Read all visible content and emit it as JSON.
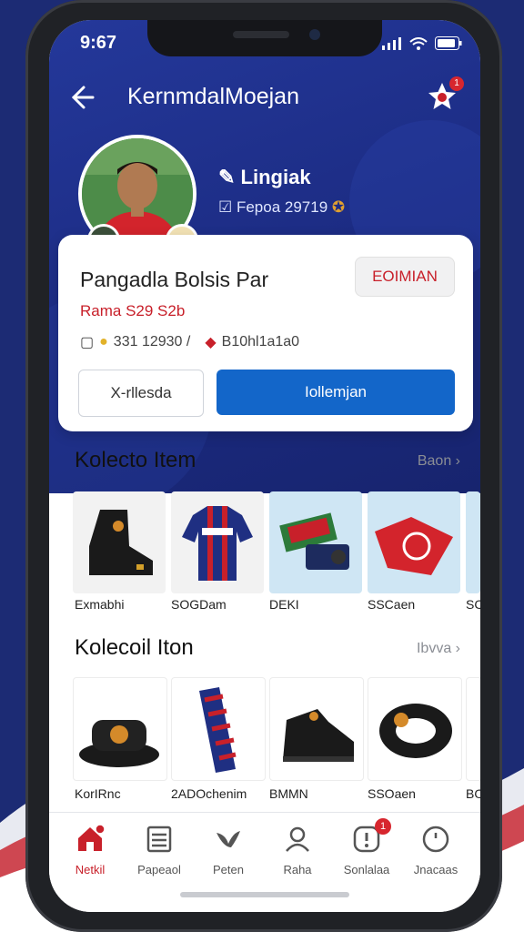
{
  "status_bar": {
    "time": "9:67"
  },
  "header": {
    "title": "KernmdalMoejan",
    "notification_count": "1"
  },
  "profile": {
    "name": "Lingiak",
    "subtitle": "Fepoa 29719"
  },
  "product": {
    "title": "Pangadla Bolsis Par",
    "price": "Rama S29 S2b",
    "action_label": "EOIMIAN",
    "meta_code": "331 12930 /",
    "meta_brand": "B10hl1a1a0",
    "secondary_button": "X-rllesda",
    "primary_button": "Iollemjan"
  },
  "sections": [
    {
      "title": "Kolecto Item",
      "more_label": "Baon",
      "items": [
        {
          "label": "Exmabhi",
          "icon": "boot-icon"
        },
        {
          "label": "SOGDam",
          "icon": "jersey-icon"
        },
        {
          "label": "DEKI",
          "icon": "bag-icon"
        },
        {
          "label": "SSCaen",
          "icon": "shirt-icon"
        },
        {
          "label": "SC",
          "icon": "item-icon"
        }
      ]
    },
    {
      "title": "Kolecoil Iton",
      "more_label": "Ibvva",
      "items": [
        {
          "label": "KorIRnc",
          "icon": "slide-icon"
        },
        {
          "label": "2ADOchenim",
          "icon": "scarf-icon"
        },
        {
          "label": "BMMN",
          "icon": "shoe-icon"
        },
        {
          "label": "SSOaen",
          "icon": "armband-icon"
        },
        {
          "label": "BO",
          "icon": "item-icon"
        }
      ]
    }
  ],
  "tabs": [
    {
      "label": "Netkil",
      "icon": "home-icon",
      "active": true,
      "badge": ""
    },
    {
      "label": "Papeaol",
      "icon": "list-icon",
      "active": false,
      "badge": ""
    },
    {
      "label": "Peten",
      "icon": "bird-icon",
      "active": false,
      "badge": ""
    },
    {
      "label": "Raha",
      "icon": "person-icon",
      "active": false,
      "badge": ""
    },
    {
      "label": "Sonlalaa",
      "icon": "alert-icon",
      "active": false,
      "badge": "1"
    },
    {
      "label": "Jnacaas",
      "icon": "circle-icon",
      "active": false,
      "badge": ""
    }
  ],
  "colors": {
    "brand_blue": "#1b2a80",
    "primary": "#1366c9",
    "accent_red": "#c8202a"
  }
}
